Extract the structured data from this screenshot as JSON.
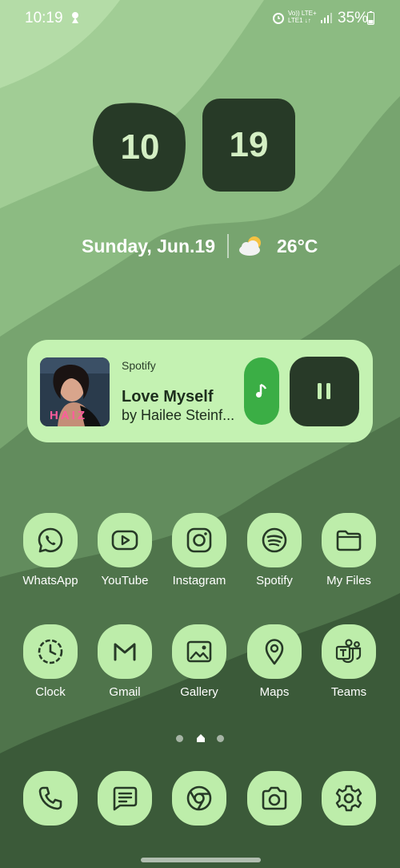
{
  "status_bar": {
    "time": "10:19",
    "network_line1": "Vo)) LTE+",
    "network_line2": "LTE1 ↓↑",
    "battery": "35%"
  },
  "clock": {
    "hour": "10",
    "minute": "19"
  },
  "date_weather": {
    "date": "Sunday, Jun.19",
    "temperature": "26°C",
    "weather_icon": "partly-cloudy-icon"
  },
  "media": {
    "app": "Spotify",
    "title": "Love Myself",
    "artist": "by Hailee Steinf...",
    "album_text": "HAIZ",
    "state": "playing"
  },
  "apps_row1": [
    {
      "label": "WhatsApp",
      "icon": "whatsapp-icon"
    },
    {
      "label": "YouTube",
      "icon": "youtube-icon"
    },
    {
      "label": "Instagram",
      "icon": "instagram-icon"
    },
    {
      "label": "Spotify",
      "icon": "spotify-icon"
    },
    {
      "label": "My Files",
      "icon": "folder-icon"
    }
  ],
  "apps_row2": [
    {
      "label": "Clock",
      "icon": "clock-icon"
    },
    {
      "label": "Gmail",
      "icon": "gmail-icon"
    },
    {
      "label": "Gallery",
      "icon": "gallery-icon"
    },
    {
      "label": "Maps",
      "icon": "map-pin-icon"
    },
    {
      "label": "Teams",
      "icon": "teams-icon"
    }
  ],
  "dock": [
    {
      "icon": "phone-icon"
    },
    {
      "icon": "messages-icon"
    },
    {
      "icon": "chrome-icon"
    },
    {
      "icon": "camera-icon"
    },
    {
      "icon": "settings-icon"
    }
  ],
  "pages": {
    "current": 2,
    "total": 3
  },
  "colors": {
    "icon_bg": "#bdedaa",
    "icon_fg": "#273a27",
    "widget_bg": "#c4f2b2",
    "accent_green": "#3bae45",
    "dark": "#283a28"
  }
}
